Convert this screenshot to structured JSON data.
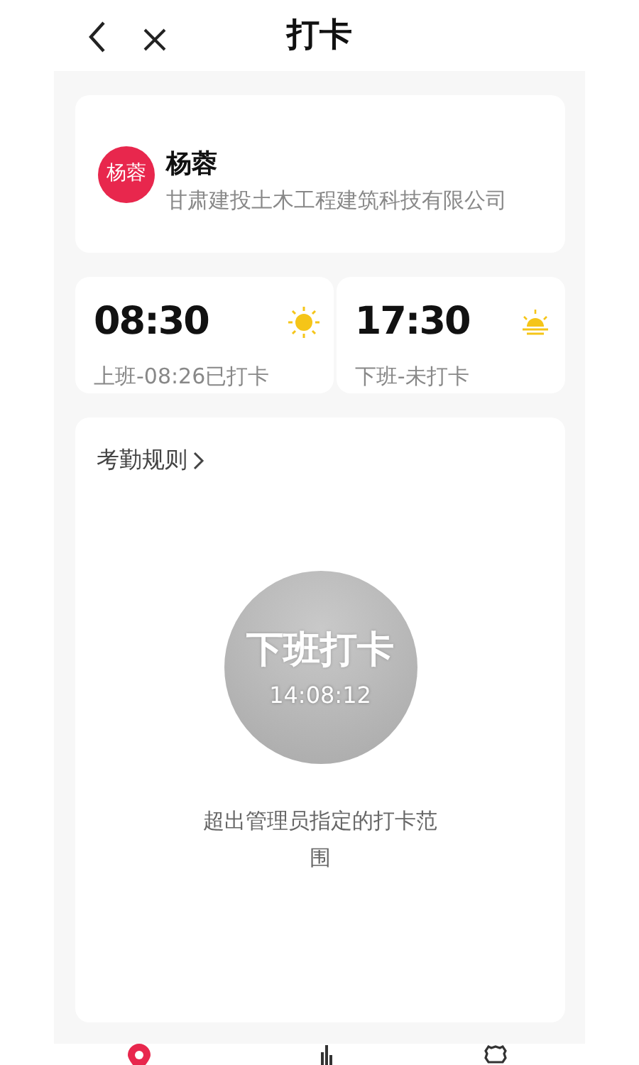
{
  "header": {
    "title": "打卡"
  },
  "profile": {
    "avatar_text": "杨蓉",
    "name": "杨蓉",
    "company": "甘肃建投土木工程建筑科技有限公司"
  },
  "shifts": [
    {
      "time": "08:30",
      "status": "上班-08:26已打卡",
      "kind": "sun"
    },
    {
      "time": "17:30",
      "status": "下班-未打卡",
      "kind": "sunset"
    }
  ],
  "rules": {
    "link": "考勤规则"
  },
  "punch": {
    "label": "下班打卡",
    "clock": "14:08:12",
    "disabled": true,
    "note": "超出管理员指定的打卡范围"
  },
  "tab_bar": [
    {
      "kind": "pin",
      "selected": true
    },
    {
      "kind": "chart",
      "selected": false
    },
    {
      "kind": "gear",
      "selected": false
    }
  ]
}
